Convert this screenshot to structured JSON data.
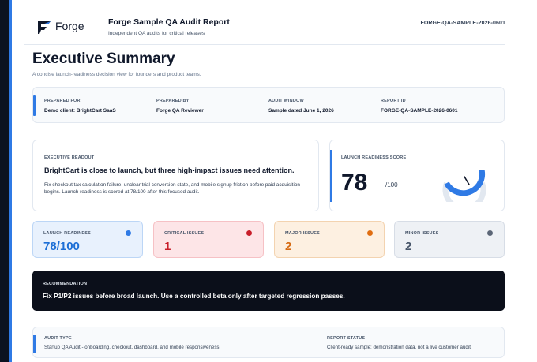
{
  "colors": {
    "accent": "#2f7ae5",
    "critical": "#c81e2a",
    "major": "#e06d10",
    "minor": "#5b6677",
    "dark": "#0b0f1a"
  },
  "header": {
    "logo_text": "Forge",
    "title": "Forge Sample QA Audit Report",
    "subtitle": "Independent QA audits for critical releases",
    "report_id": "FORGE-QA-SAMPLE-2026-0601"
  },
  "page": {
    "title": "Executive Summary",
    "subtitle": "A concise launch-readiness decision view for founders and product teams."
  },
  "meta": [
    {
      "label": "PREPARED FOR",
      "value": "Demo client: BrightCart SaaS"
    },
    {
      "label": "PREPARED BY",
      "value": "Forge QA Reviewer"
    },
    {
      "label": "AUDIT WINDOW",
      "value": "Sample dated June 1, 2026"
    },
    {
      "label": "REPORT ID",
      "value": "FORGE-QA-SAMPLE-2026-0601"
    }
  ],
  "readout": {
    "label": "EXECUTIVE READOUT",
    "headline": "BrightCart is close to launch, but three high-impact issues need attention.",
    "body": "Fix checkout tax calculation failure, unclear trial conversion state, and mobile signup friction before paid acquisition begins. Launch readiness is scored at 78/100 after this focused audit."
  },
  "score": {
    "label": "LAUNCH READINESS SCORE",
    "value": "78",
    "denominator": "/100",
    "fraction": 0.78
  },
  "stats": [
    {
      "label": "LAUNCH READINESS",
      "value": "78/100"
    },
    {
      "label": "CRITICAL ISSUES",
      "value": "1"
    },
    {
      "label": "MAJOR ISSUES",
      "value": "2"
    },
    {
      "label": "MINOR ISSUES",
      "value": "2"
    }
  ],
  "recommendation": {
    "label": "RECOMMENDATION",
    "text": "Fix P1/P2 issues before broad launch. Use a controlled beta only after targeted regression passes."
  },
  "audit": [
    {
      "label": "AUDIT TYPE",
      "value": "Startup QA Audit - onboarding, checkout, dashboard, and mobile responsiveness"
    },
    {
      "label": "REPORT STATUS",
      "value": "Client-ready sample; demonstration data, not a live customer audit."
    }
  ]
}
